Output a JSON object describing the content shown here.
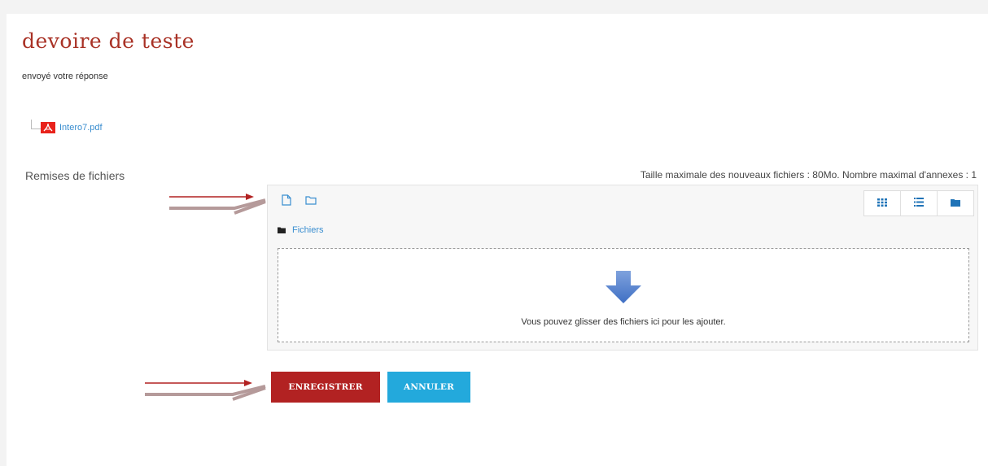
{
  "page": {
    "title": "devoire de teste",
    "subtitle": "envoyé  votre réponse"
  },
  "submitted_file": {
    "name": "Intero7.pdf",
    "icon": "pdf-icon"
  },
  "file_submissions": {
    "label": "Remises de fichiers",
    "limits": "Taille maximale des nouveaux fichiers : 80Mo. Nombre maximal d'annexes : 1",
    "toolbar": {
      "add_file_icon": "file-icon",
      "create_folder_icon": "folder-outline-icon",
      "view_icons": [
        "grid-icon",
        "list-icon",
        "folder-tree-icon"
      ]
    },
    "breadcrumb": "Fichiers",
    "dropzone_message": "Vous pouvez glisser des fichiers ici pour les ajouter."
  },
  "buttons": {
    "save": "ENREGISTRER",
    "cancel": "ANNULER"
  },
  "colors": {
    "title": "#a93226",
    "link": "#3a8ed0",
    "save_button": "#b22222",
    "cancel_button": "#23a9dc",
    "annotation_arrow": "#b08080"
  }
}
